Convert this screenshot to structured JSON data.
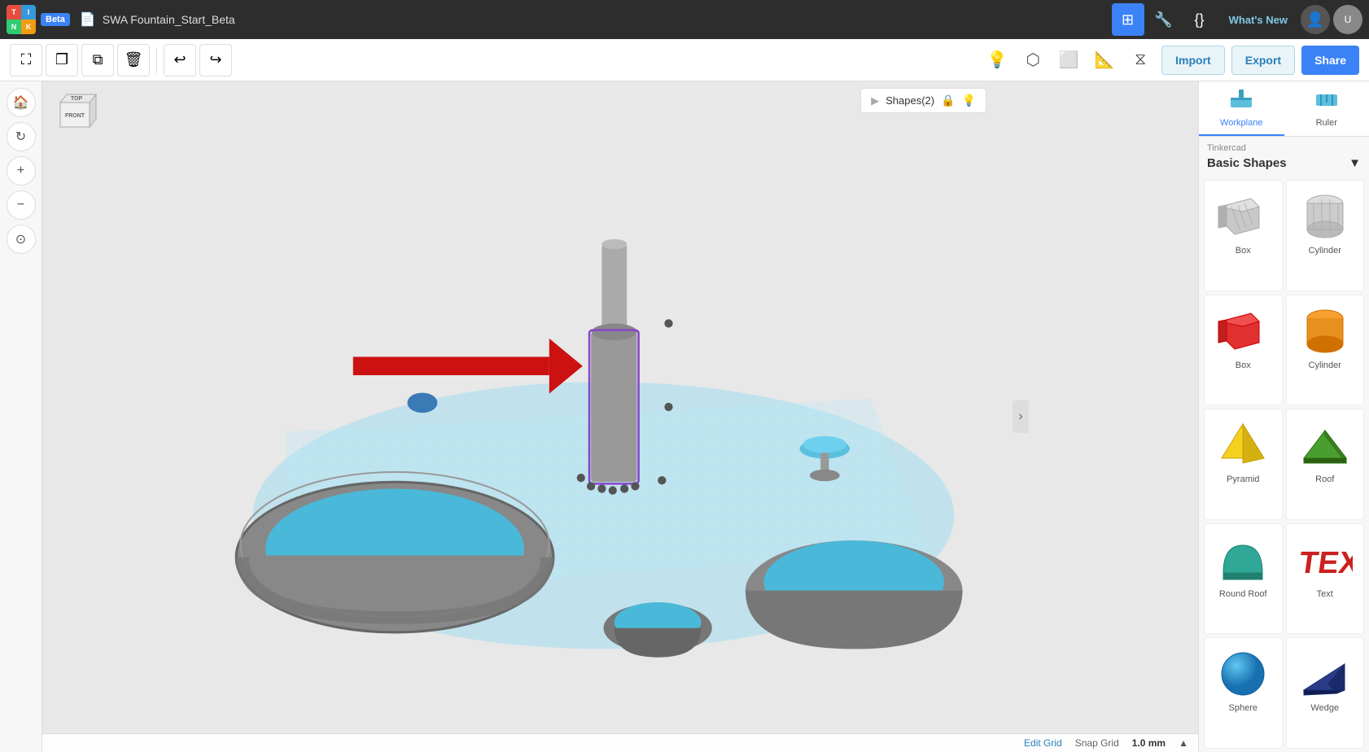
{
  "app": {
    "logo_letters": [
      "T",
      "I",
      "N",
      "K"
    ],
    "beta_label": "Beta",
    "file_title": "SWA Fountain_Start_Beta",
    "whats_new": "What's New"
  },
  "toolbar": {
    "tools": [
      {
        "name": "move",
        "icon": "⛶",
        "label": "Move"
      },
      {
        "name": "duplicate",
        "icon": "❐",
        "label": "Duplicate"
      },
      {
        "name": "copy",
        "icon": "⧉",
        "label": "Copy"
      },
      {
        "name": "delete",
        "icon": "🗑",
        "label": "Delete"
      },
      {
        "name": "undo",
        "icon": "↩",
        "label": "Undo"
      },
      {
        "name": "redo",
        "icon": "↪",
        "label": "Redo"
      }
    ],
    "right_icons": [
      "💡",
      "⬡",
      "⬜",
      "🔀",
      "⧖"
    ],
    "import_label": "Import",
    "export_label": "Export",
    "share_label": "Share"
  },
  "viewport": {
    "shapes_panel_label": "Shapes(2)"
  },
  "bottom_bar": {
    "edit_grid": "Edit Grid",
    "snap_grid_label": "Snap Grid",
    "snap_grid_value": "1.0 mm"
  },
  "right_panel": {
    "workplane_label": "Workplane",
    "ruler_label": "Ruler",
    "library_brand": "Tinkercad",
    "library_name": "Basic Shapes",
    "shapes": [
      {
        "name": "Box",
        "type": "box-gray"
      },
      {
        "name": "Cylinder",
        "type": "cylinder-gray"
      },
      {
        "name": "Box",
        "type": "box-red"
      },
      {
        "name": "Cylinder",
        "type": "cylinder-orange"
      },
      {
        "name": "Pyramid",
        "type": "pyramid-yellow"
      },
      {
        "name": "Roof",
        "type": "roof-green"
      },
      {
        "name": "Round Roof",
        "type": "round-roof-teal"
      },
      {
        "name": "Text",
        "type": "text-red"
      },
      {
        "name": "Sphere",
        "type": "sphere-blue"
      },
      {
        "name": "Wedge",
        "type": "wedge-navy"
      }
    ]
  }
}
